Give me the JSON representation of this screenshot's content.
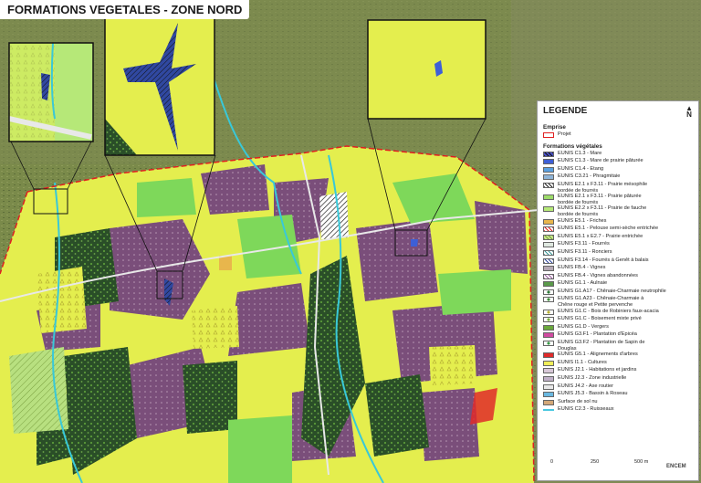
{
  "title": "FORMATIONS VEGETALES - ZONE NORD",
  "legend": {
    "heading": "LEGENDE",
    "north": "N",
    "emprise_heading": "Emprise",
    "projet_label": "Projet",
    "formations_heading": "Formations végétales",
    "items": [
      {
        "label": "EUNIS C1.3 - Mare",
        "color": "#4a52c8",
        "pattern": "hatch-dark"
      },
      {
        "label": "EUNIS C1.3 - Mare de prairie pâturée",
        "color": "#3e5fd6",
        "pattern": "solid"
      },
      {
        "label": "EUNIS C1.4 - Etang",
        "color": "#5aa0e0",
        "pattern": "solid"
      },
      {
        "label": "EUNIS C3.21 - Phragmitaie",
        "color": "#8fb5d8",
        "pattern": "solid"
      },
      {
        "label": "EUNIS E2.1 x F3.11 - Prairie mésophile\nbordée de fourrés",
        "color": "#ffffff",
        "pattern": "hatch-black"
      },
      {
        "label": "EUNIS E2.1 x F3.11 - Prairie pâturée\nbordée de fourrés",
        "color": "#9ddc6a",
        "pattern": "solid"
      },
      {
        "label": "EUNIS E2.2 x F3.11 - Prairie de fauche\nbordée de fourrés",
        "color": "#b6ea78",
        "pattern": "solid"
      },
      {
        "label": "EUNIS E5.1 - Friches",
        "color": "#e8b64c",
        "pattern": "solid"
      },
      {
        "label": "EUNIS E5.1 - Pelouse semi-sèche entrichée",
        "color": "#ffffff",
        "pattern": "hatch-red"
      },
      {
        "label": "EUNIS E5.1 x E2.7 - Prairie entrichée",
        "color": "#c8e88c",
        "pattern": "hatch-green"
      },
      {
        "label": "EUNIS F3.11 - Fourrés",
        "color": "#dfe8e0",
        "pattern": "solid"
      },
      {
        "label": "EUNIS F3.11 - Ronciers",
        "color": "#ffffff",
        "pattern": "hatch-teal"
      },
      {
        "label": "EUNIS F3.14 - Fourrés à Genêt à balais",
        "color": "#ffffff",
        "pattern": "hatch-blue"
      },
      {
        "label": "EUNIS FB.4 - Vignes",
        "color": "#b5a9b5",
        "pattern": "solid"
      },
      {
        "label": "EUNIS FB.4 - Vignes abandonnées",
        "color": "#ffffff",
        "pattern": "hatch-purple"
      },
      {
        "label": "EUNIS G1.1 - Aulnaie",
        "color": "#5a9a4a",
        "pattern": "solid"
      },
      {
        "label": "EUNIS G1.A17 - Chênaie-Charmaie neutrophile",
        "color": "#2f7a3a",
        "pattern": "dot"
      },
      {
        "label": "EUNIS G1.A23 - Chênaie-Charmaie à\nChêne rouge et Petite pervenche",
        "color": "#3f8f3a",
        "pattern": "dot"
      },
      {
        "label": "EUNIS G1.C - Bois de Robiniers faux-acacia",
        "color": "#b8b032",
        "pattern": "dot"
      },
      {
        "label": "EUNIS G1.C - Boisement mixte privé",
        "color": "#7ab040",
        "pattern": "dot"
      },
      {
        "label": "EUNIS G1.D - Vergers",
        "color": "#6aa83c",
        "pattern": "solid"
      },
      {
        "label": "EUNIS G3.F1 - Plantation d'Epicéa",
        "color": "#d04aa0",
        "pattern": "solid"
      },
      {
        "label": "EUNIS G3.F2 - Plantation de Sapin de\nDouglas",
        "color": "#3a9a48",
        "pattern": "dot"
      },
      {
        "label": "EUNIS G5.1 - Alignements d'arbres",
        "color": "#e02a2a",
        "pattern": "solid"
      },
      {
        "label": "EUNIS I1.1 - Cultures",
        "color": "#f0ee5a",
        "pattern": "solid"
      },
      {
        "label": "EUNIS J2.1 - Habitations et jardins",
        "color": "#d8c8d8",
        "pattern": "solid"
      },
      {
        "label": "EUNIS J2.3 - Zone industrielle",
        "color": "#c0b0c8",
        "pattern": "solid"
      },
      {
        "label": "EUNIS J4.2 - Axe routier",
        "color": "#e8e8e8",
        "pattern": "solid"
      },
      {
        "label": "EUNIS J5.3 - Bassin à Roseau",
        "color": "#6ab8e0",
        "pattern": "solid"
      },
      {
        "label": "Surface de sol nu",
        "color": "#d4a878",
        "pattern": "solid"
      },
      {
        "label": "EUNIS C2.3 - Ruisseaux",
        "color": "#4ac8e0",
        "pattern": "line"
      }
    ]
  },
  "scale": {
    "zero": "0",
    "mid": "250",
    "end": "500 m"
  },
  "logo": "ENCEM",
  "colors": {
    "cultures": "#e4ee4e",
    "vignes": "#7a4a7a",
    "forest": "#2f5a2c",
    "prairie": "#7ed85a",
    "projet": "#e02020",
    "ruisseau": "#39c8d8"
  }
}
